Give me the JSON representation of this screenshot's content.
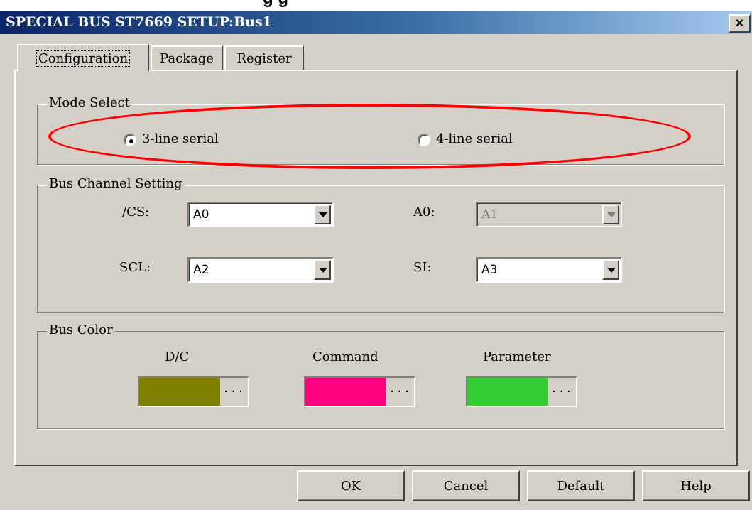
{
  "window": {
    "title": "SPECIAL BUS ST7669 SETUP:Bus1",
    "close_glyph": "×",
    "top_crop_text": "g         g"
  },
  "tabs": [
    {
      "label": "Configuration",
      "active": true
    },
    {
      "label": "Package",
      "active": false
    },
    {
      "label": "Register",
      "active": false
    }
  ],
  "mode_select": {
    "legend": "Mode Select",
    "options": [
      {
        "label": "3-line serial",
        "selected": true
      },
      {
        "label": "4-line serial",
        "selected": false
      }
    ],
    "highlight_color": "#ff0000"
  },
  "bus_channel": {
    "legend": "Bus Channel Setting",
    "fields": [
      {
        "label": "/CS:",
        "value": "A0",
        "enabled": true
      },
      {
        "label": "A0:",
        "value": "A1",
        "enabled": false
      },
      {
        "label": "SCL:",
        "value": "A2",
        "enabled": true
      },
      {
        "label": "SI:",
        "value": "A3",
        "enabled": true
      }
    ]
  },
  "bus_color": {
    "legend": "Bus Color",
    "items": [
      {
        "label": "D/C",
        "color": "#808000",
        "button": "···"
      },
      {
        "label": "Command",
        "color": "#ff0080",
        "button": "···"
      },
      {
        "label": "Parameter",
        "color": "#33cc33",
        "button": "···"
      }
    ]
  },
  "buttons": {
    "ok": "OK",
    "cancel": "Cancel",
    "default": "Default",
    "help": "Help"
  }
}
